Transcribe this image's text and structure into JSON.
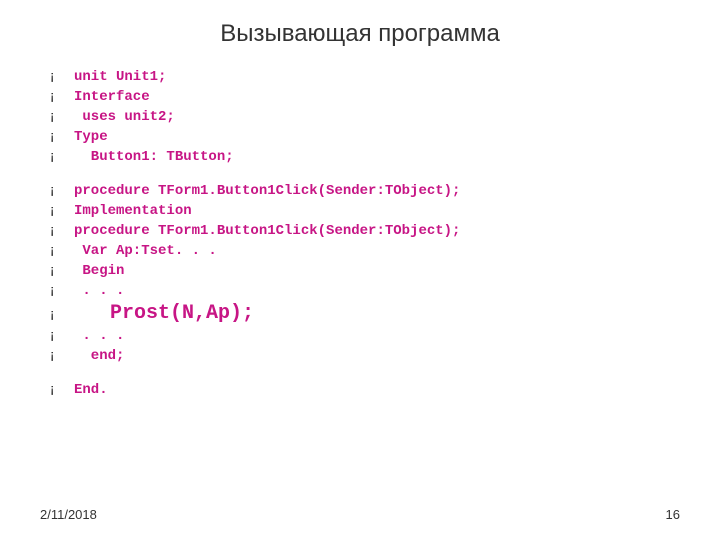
{
  "slide": {
    "title": "Вызывающая программа",
    "bullet": "¡",
    "lines": {
      "l1": "unit Unit1;",
      "l2": "Interface",
      "l3": " uses unit2;",
      "l4": "Type",
      "l5": "  Button1: TButton;",
      "l6": "procedure TForm1.Button1Click(Sender:TObject);",
      "l7": "Implementation",
      "l8": "procedure TForm1.Button1Click(Sender:TObject);",
      "l9": " Var Ap:Tset. . .",
      "l10": " Begin",
      "l11": " . . .",
      "l12": "   Prost(N,Ap);",
      "l13": " . . .",
      "l14": "  end;",
      "l15": "End."
    },
    "footer": {
      "date": "2/11/2018",
      "page": "16"
    }
  }
}
